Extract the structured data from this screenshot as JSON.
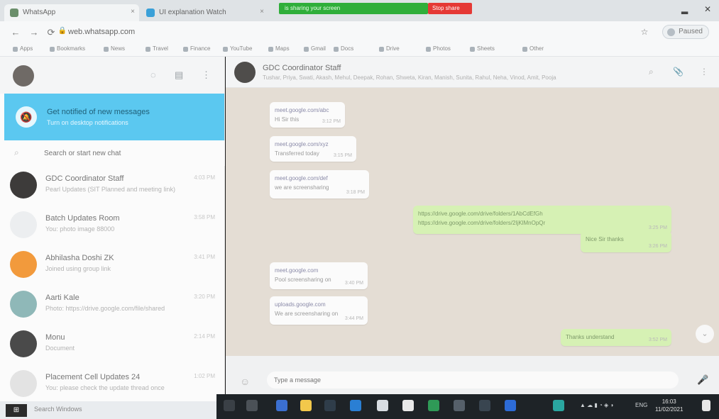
{
  "browser": {
    "tabs": [
      {
        "label": "WhatsApp",
        "close": "×"
      },
      {
        "label": "UI explanation Watch",
        "close": "×"
      }
    ],
    "share_bar": "is sharing your screen",
    "stop_share": "Stop share",
    "url": "web.whatsapp.com",
    "profile_label": "Paused",
    "bookmarks": [
      "Apps",
      "Bookmarks",
      "News",
      "Travel",
      "Finance",
      "YouTube",
      "Maps",
      "Gmail",
      "Docs",
      "Drive",
      "Photos",
      "Sheets",
      "Other"
    ]
  },
  "sidebar": {
    "notification": {
      "title": "Get notified of new messages",
      "subtitle": "Turn on desktop notifications"
    },
    "search_placeholder": "Search or start new chat",
    "chats": [
      {
        "name": "GDC Coordinator Staff",
        "preview": "Pearl Updates (SIT Planned and meeting link)",
        "time": "4:03 PM",
        "color": "#3d3b3a"
      },
      {
        "name": "Batch Updates Room",
        "preview": "You: photo image 88000",
        "time": "3:58 PM",
        "color": "#eceef0"
      },
      {
        "name": "Abhilasha Doshi ZK",
        "preview": "Joined using group link",
        "time": "3:41 PM",
        "color": "#f29a3c"
      },
      {
        "name": "Aarti Kale",
        "preview": "Photo: https://drive.google.com/file/shared",
        "time": "3:20 PM",
        "color": "#8fb8b8"
      },
      {
        "name": "Monu",
        "preview": "Document",
        "time": "2:14 PM",
        "color": "#4a4a4a"
      },
      {
        "name": "Placement Cell Updates 24",
        "preview": "You: please check the update thread once",
        "time": "1:02 PM",
        "color": "#e3e3e3"
      }
    ]
  },
  "conversation": {
    "name": "GDC Coordinator Staff",
    "members": "Tushar, Priya, Swati, Akash, Mehul, Deepak, Rohan, Shweta, Kiran, Manish, Sunita, Rahul, Neha, Vinod, Amit, Pooja",
    "messages": [
      {
        "dir": "in",
        "line1": "meet.google.com/abc",
        "line2": "Hi Sir this",
        "time": "3:12 PM"
      },
      {
        "dir": "in",
        "line1": "meet.google.com/xyz",
        "line2": "Transferred today",
        "time": "3:15 PM"
      },
      {
        "dir": "in",
        "line1": "meet.google.com/def",
        "line2": "we are screensharing",
        "time": "3:18 PM"
      },
      {
        "dir": "out",
        "line1": "https://drive.google.com/drive/folders/1AbCdEfGh",
        "line2": "https://drive.google.com/drive/folders/2IjKlMnOpQr",
        "time": "3:25 PM"
      },
      {
        "dir": "out",
        "line1": "Nice Sir thanks",
        "line2": "",
        "time": "3:26 PM"
      },
      {
        "dir": "in",
        "line1": "meet.google.com",
        "line2": "Pool screensharing on",
        "time": "3:40 PM"
      },
      {
        "dir": "in",
        "line1": "uploads.google.com",
        "line2": "We are screensharing on",
        "time": "3:44 PM"
      },
      {
        "dir": "out",
        "line1": "Thanks understand",
        "line2": "",
        "time": "3:52 PM"
      }
    ],
    "composer_placeholder": "Type a message"
  },
  "taskbar": {
    "start": "⊞",
    "search": "Search Windows",
    "tray": "ENG",
    "time": "16:03",
    "date": "11/02/2021"
  }
}
